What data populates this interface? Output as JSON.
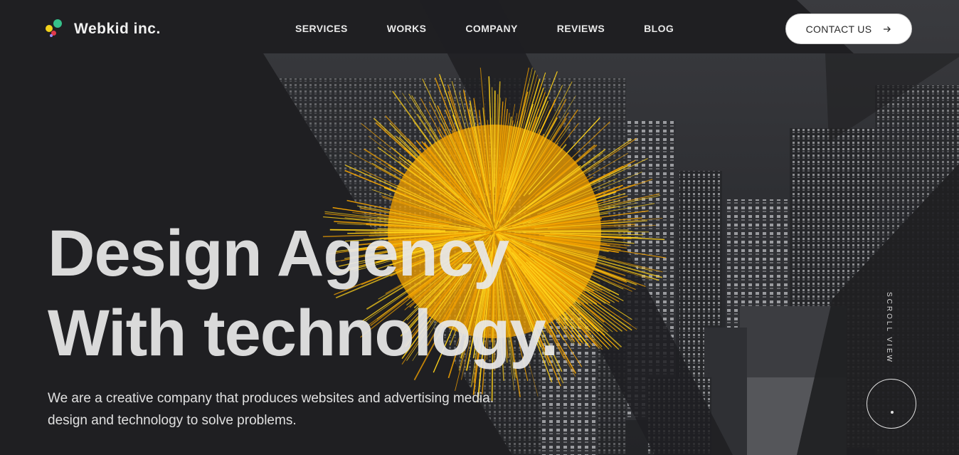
{
  "brand": {
    "name": "Webkid inc.",
    "logo_colors": [
      "#36c08a",
      "#f2d21b",
      "#e0394b",
      "#9b8cff"
    ]
  },
  "nav": {
    "items": [
      {
        "label": "SERVICES"
      },
      {
        "label": "WORKS"
      },
      {
        "label": "COMPANY"
      },
      {
        "label": "REVIEWS"
      },
      {
        "label": "BLOG"
      }
    ]
  },
  "contact": {
    "label": "CONTACT US",
    "icon": "arrow-right-icon"
  },
  "hero": {
    "title_line1": "Design Agency",
    "title_line2": "With technology.",
    "desc_line1": "We are a creative company that produces websites and advertising media.",
    "desc_line2": "design and technology to solve problems."
  },
  "scroll": {
    "label": "SCROLL VIEW"
  },
  "colors": {
    "background": "#1f1f22",
    "accent": "#f5a300",
    "accent_light": "#ffd21a"
  }
}
